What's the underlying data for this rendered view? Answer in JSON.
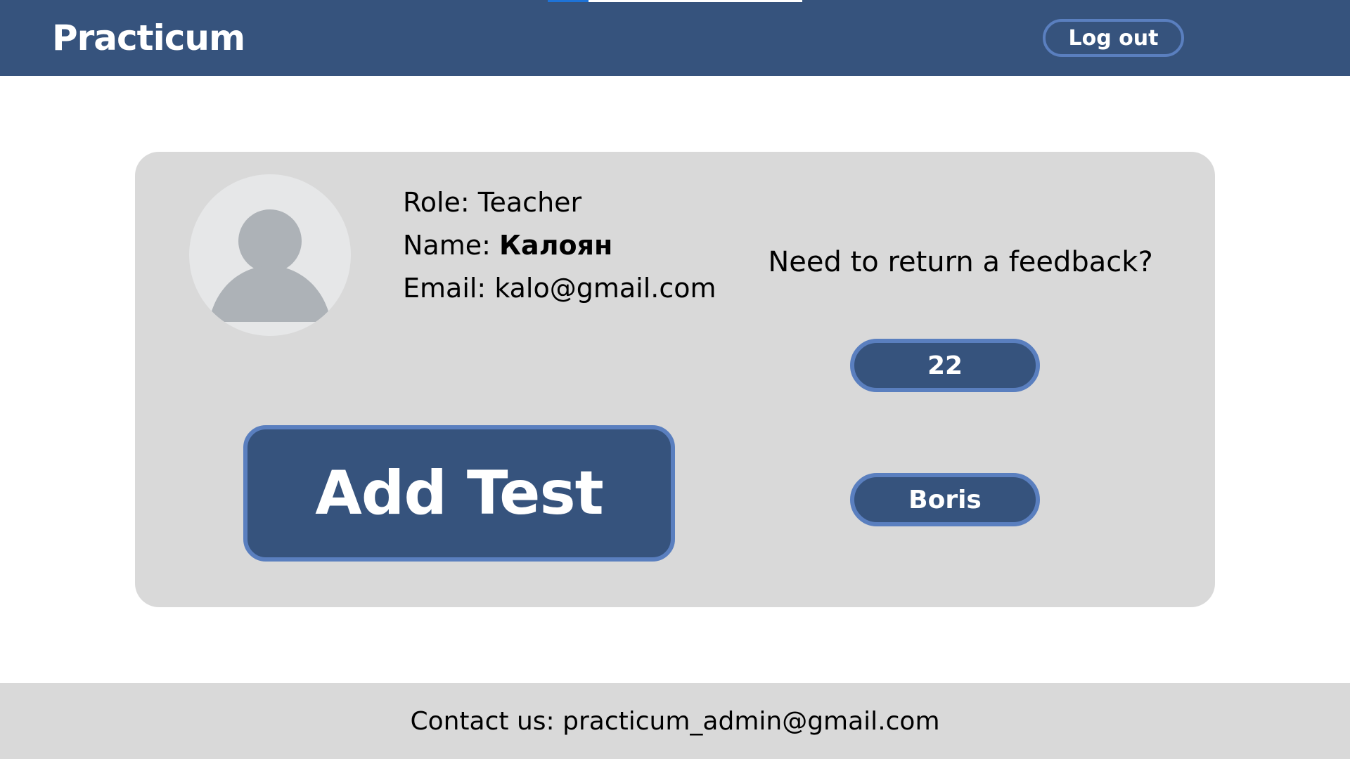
{
  "colors": {
    "header_bg": "#36537d",
    "button_border": "#5a7fbf",
    "card_bg": "#d9d9d9",
    "footer_bg": "#d9d9d9",
    "loading_accent": "#1e73d8",
    "avatar_bg": "#e6e7e8",
    "avatar_figure": "#adb2b7"
  },
  "header": {
    "brand": "Practicum",
    "logout_label": "Log out",
    "loading_progress": 0.16
  },
  "profile": {
    "avatar_icon": "user-avatar-icon",
    "role_label": "Role: ",
    "role_value": "Teacher",
    "name_label": "Name: ",
    "name_value": "Калоян",
    "email_label": "Email: ",
    "email_value": "kalo@gmail.com"
  },
  "feedback": {
    "question": "Need to return a feedback?",
    "count_label": "22",
    "student_label": "Boris"
  },
  "actions": {
    "add_test_label": "Add Test"
  },
  "footer": {
    "contact": "Contact us: practicum_admin@gmail.com"
  }
}
